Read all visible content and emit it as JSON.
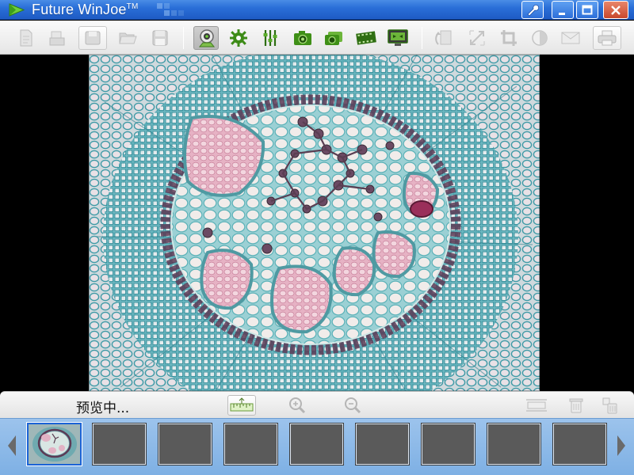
{
  "window": {
    "title": "Future WinJoe",
    "trademark": "TM",
    "buttons": [
      "settings",
      "minimize",
      "maximize",
      "close"
    ]
  },
  "toolbar": {
    "left_group": [
      "new-icon",
      "open-icon",
      "save-disabled-icon",
      "folder-icon",
      "save-icon"
    ],
    "capture_group": [
      "camera-source-icon",
      "gear-icon",
      "sliders-icon",
      "camera-icon",
      "video-camera-icon",
      "film-icon",
      "monitor-icon"
    ],
    "edit_group": [
      "rotate-icon",
      "resize-icon",
      "crop-icon",
      "contrast-icon",
      "email-icon",
      "print-icon"
    ]
  },
  "status": {
    "text": "预览中..."
  },
  "preview_controls": [
    "ruler-icon",
    "zoom-in-icon",
    "zoom-out-icon"
  ],
  "thumbnail_actions": [
    "fit-icon",
    "trash-icon",
    "delete-all-icon"
  ],
  "thumbnails": {
    "count": 9,
    "selected_index": 0
  },
  "colors": {
    "titlebar": "#2a6fd8",
    "thumb_strip": "#8cbae9",
    "selected_thumb_border": "#1b63d6",
    "stain_teal": "#4aa8b4",
    "stain_pink": "#d996b0"
  }
}
